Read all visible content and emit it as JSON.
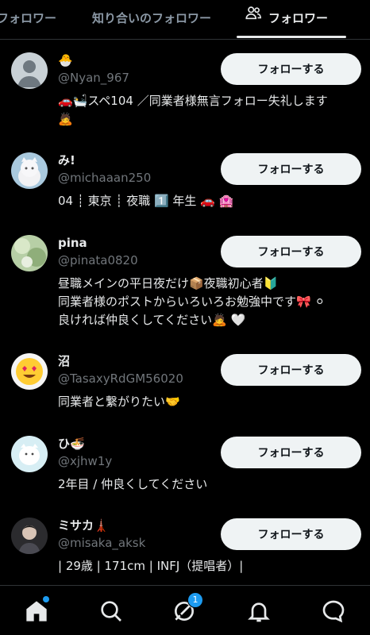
{
  "tabs": [
    {
      "label": "フォロワー"
    },
    {
      "label": "知り合いのフォロワー"
    },
    {
      "label": "フォロワー"
    }
  ],
  "follow_label": "フォローする",
  "users": [
    {
      "name": "🐣",
      "handle": "@Nyan_967",
      "bio": [
        "🚗🛀スペ104 ／同業者様無言フォロー失礼します",
        "🙇"
      ]
    },
    {
      "name": "み!",
      "handle": "@michaaan250",
      "bio": [
        "04 ┊ 東京 ┊ 夜職 1️⃣ 年生 🚗 🏩"
      ]
    },
    {
      "name": "pina",
      "handle": "@pinata0820",
      "bio": [
        "昼職メインの平日夜だけ📦夜職初心者🔰",
        "同業者様のポストからいろいろお勉強中です🎀 ⚪",
        "良ければ仲良くしてください🙇 🤍"
      ]
    },
    {
      "name": "沼",
      "handle": "@TasaxyRdGM56020",
      "bio": [
        "同業者と繋がりたい🤝"
      ]
    },
    {
      "name": "ひ🍜",
      "handle": "@xjhw1y",
      "bio": [
        "2年目 / 仲良くしてください"
      ]
    },
    {
      "name": "ミサカ🗼",
      "handle": "@misaka_aksk",
      "bio": [
        "| 29歳 | 171cm | INFJ（提唱者）|"
      ]
    }
  ],
  "nav": {
    "messages_badge": "1"
  },
  "colors": {
    "accent": "#1d9bf0",
    "background": "#000000",
    "button": "#eff3f4"
  }
}
